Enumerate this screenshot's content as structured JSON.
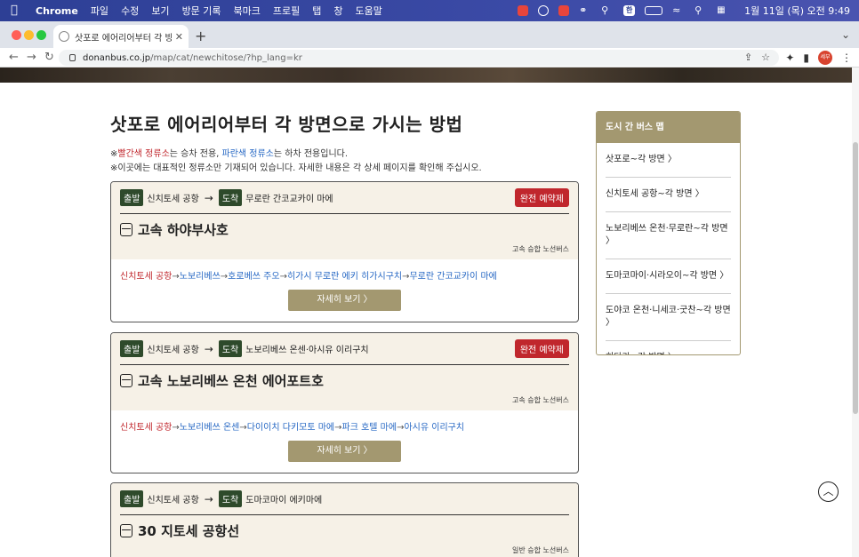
{
  "menubar": {
    "app": "Chrome",
    "items": [
      "파일",
      "수정",
      "보기",
      "방문 기록",
      "북마크",
      "프로필",
      "탭",
      "창",
      "도움말"
    ],
    "lang_badge": "한",
    "clock": "1월 11일 (목) 오전 9:49"
  },
  "browser": {
    "tab_title": "삿포로 에어리어부터 각 방면으로 가",
    "url_domain": "donanbus.co.jp",
    "url_path": "/map/cat/newchitose/?hp_lang=kr",
    "profile_label": "세부"
  },
  "page": {
    "title": "삿포로 에어리어부터 각 방면으로 가시는 방법",
    "note1": {
      "prefix": "※",
      "red": "빨간색 정류소",
      "mid": "는 승차 전용, ",
      "blue": "파란색 정류소",
      "suffix": "는 하차 전용입니다."
    },
    "note2": "※이곳에는 대표적인 정류소만 기재되어 있습니다. 자세한 내용은 각 상세 페이지를 확인해 주십시오."
  },
  "labels": {
    "depart": "출발",
    "arrive": "도착",
    "arrow": "→",
    "reserve": "완전 예약제",
    "detail": "자세히 보기 〉"
  },
  "cards": [
    {
      "from": "신치토세 공항",
      "to": "무로란 간코교카이 마에",
      "reserved": true,
      "bus": "고속 하야부사호",
      "type": "고속 승합 노선버스",
      "route_start": "신치토세 공항",
      "route_rest": [
        "노보리베쓰",
        "호로베쓰 주오",
        "히가시 무로란 에키 히가시구치",
        "무로란 간코교카이 마에"
      ]
    },
    {
      "from": "신치토세 공항",
      "to": "노보리베쓰 온센·아시유 이리구치",
      "reserved": true,
      "bus": "고속 노보리베쓰 온천 에어포트호",
      "type": "고속 승합 노선버스",
      "route_start": "신치토세 공항",
      "route_rest": [
        "노보리베쓰 온센",
        "다이이치 다키모토 마에",
        "파크 호텔 마에",
        "아시유 이리구치"
      ]
    },
    {
      "from": "신치토세 공항",
      "to": "도마코마이 에키마에",
      "reserved": false,
      "bus": "30 지토세 공항선",
      "type": "일반 승합 노선버스"
    }
  ],
  "sidebar": {
    "title": "도시 간 버스 맵",
    "items": [
      "삿포로~각 방면 〉",
      "신치토세 공항~각 방면 〉",
      "노보리베쓰 온천·무로란~각 방면 〉",
      "도마코마이·시라오이~각 방면 〉",
      "도야코 온천·니세코·굿찬~각 방면 〉",
      "히다카~각 방면 〉"
    ]
  }
}
